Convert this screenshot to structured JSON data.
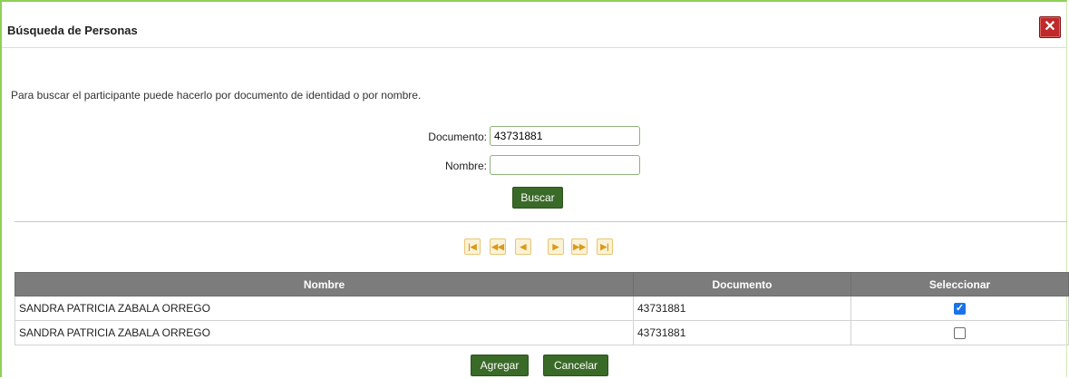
{
  "dialog": {
    "title": "Búsqueda de Personas",
    "close_glyph": "✕",
    "close_icon": "close-icon",
    "accent_color": "#8fcf57",
    "close_color": "#c0282a"
  },
  "intro_text": "Para buscar el participante puede hacerlo por documento de identidad o por nombre.",
  "form": {
    "documento_label": "Documento:",
    "documento_value": "43731881",
    "nombre_label": "Nombre:",
    "nombre_value": "",
    "search_button": "Buscar"
  },
  "pager": {
    "icons": [
      "first-page-icon",
      "rewind-icon",
      "prev-page-icon",
      "next-page-icon",
      "fast-forward-icon",
      "last-page-icon"
    ],
    "glyphs": [
      "|◀",
      "◀◀",
      "◀",
      "▶",
      "▶▶",
      "▶|"
    ],
    "color": "#d99a1b"
  },
  "table": {
    "headers": [
      "Nombre",
      "Documento",
      "Seleccionar"
    ],
    "rows": [
      {
        "nombre": "SANDRA PATRICIA ZABALA ORREGO",
        "documento": "43731881",
        "selected": true
      },
      {
        "nombre": "SANDRA PATRICIA ZABALA ORREGO",
        "documento": "43731881",
        "selected": false
      }
    ],
    "header_color": "#7c7c7c"
  },
  "actions": {
    "add_button": "Agregar",
    "cancel_button": "Cancelar",
    "button_color": "#3a6a28"
  }
}
